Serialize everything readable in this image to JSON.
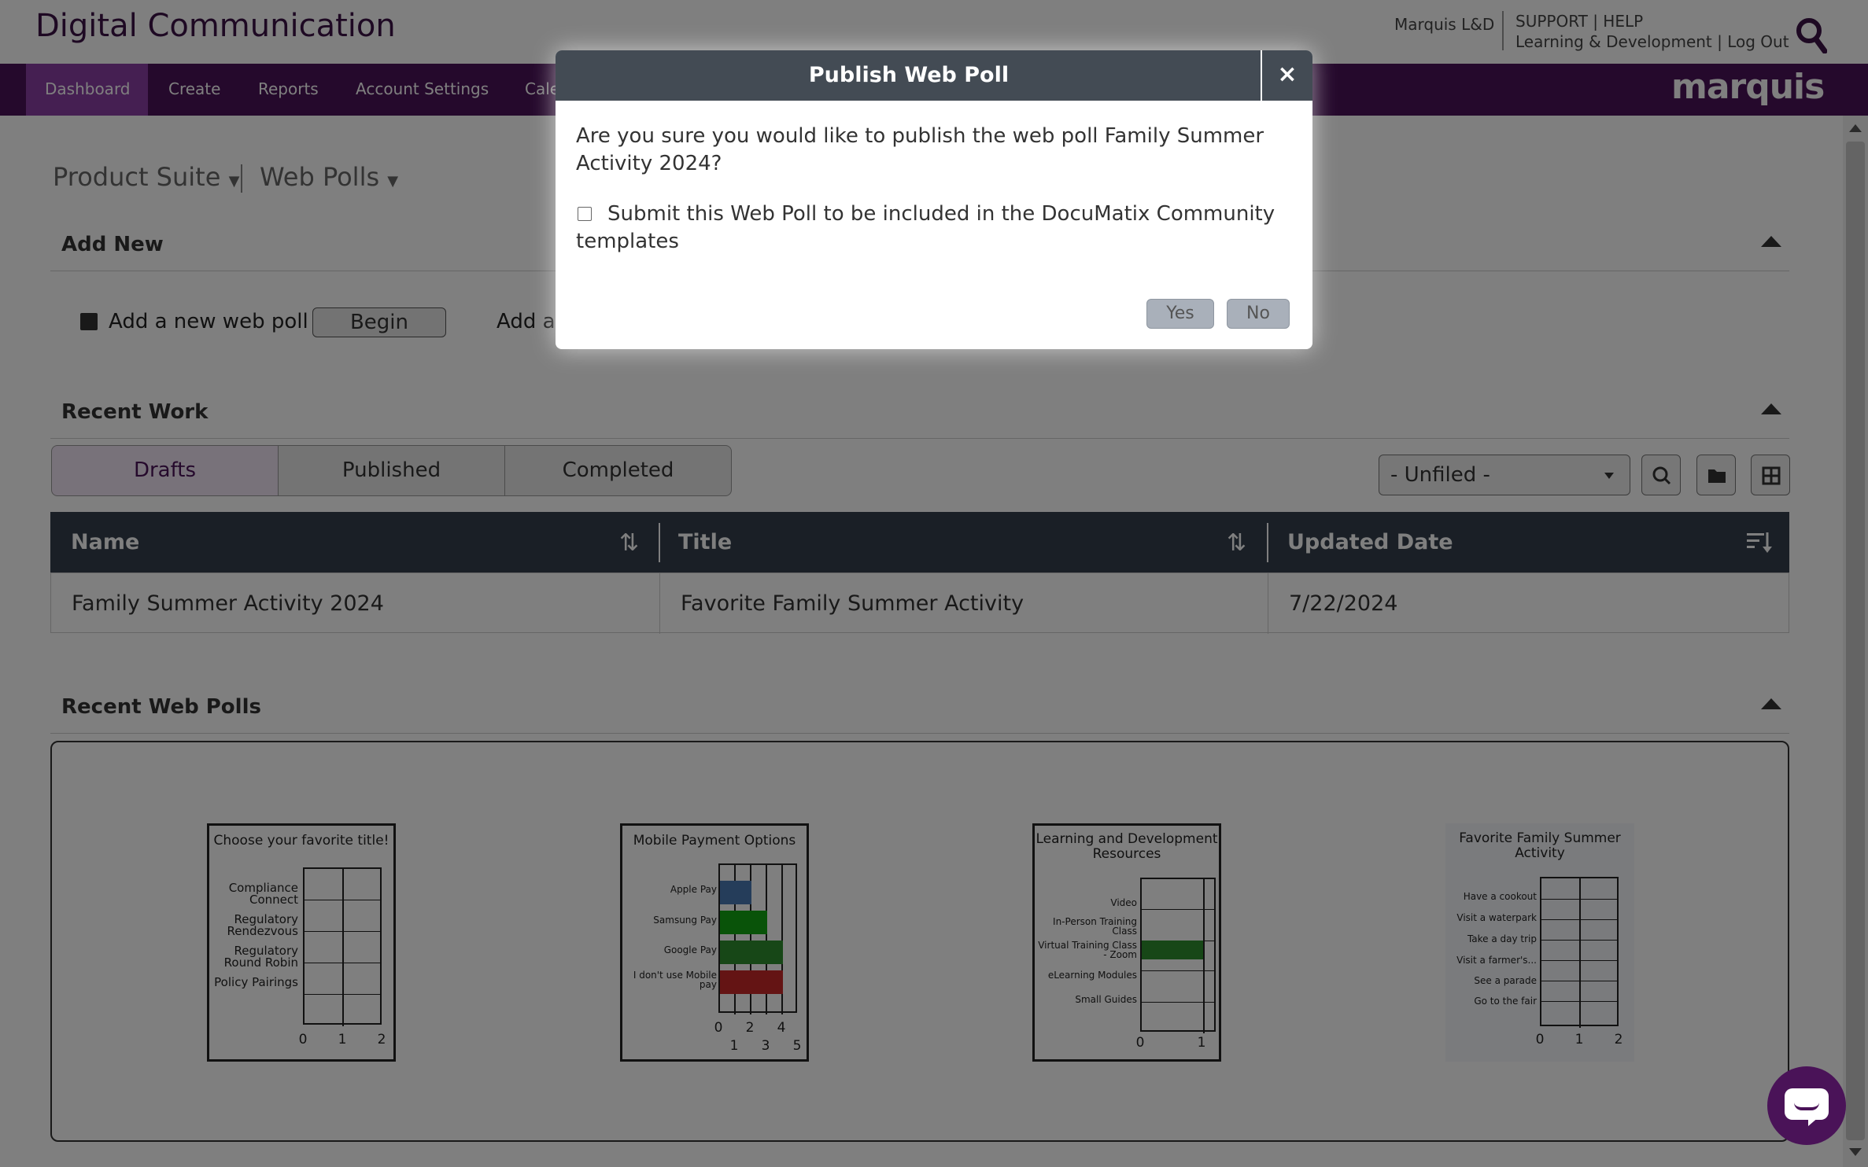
{
  "header": {
    "brand": "Digital Communication",
    "user": "Marquis L&D",
    "links_line1": "SUPPORT | HELP",
    "links_line2": "Learning & Development | Log Out",
    "logo": "marquis"
  },
  "nav": {
    "items": [
      {
        "label": "Dashboard",
        "active": true
      },
      {
        "label": "Create"
      },
      {
        "label": "Reports"
      },
      {
        "label": "Account Settings"
      },
      {
        "label": "Cale"
      }
    ]
  },
  "breadcrumb": {
    "suite": "Product Suite",
    "section": "Web Polls"
  },
  "add_new": {
    "title": "Add New",
    "new_poll_label": "Add a new web poll",
    "begin_label": "Begin",
    "second_label": "Add a"
  },
  "recent_work": {
    "title": "Recent Work",
    "tabs": [
      "Drafts",
      "Published",
      "Completed"
    ],
    "folder_select": "- Unfiled -",
    "columns": [
      "Name",
      "Title",
      "Updated Date"
    ],
    "rows": [
      {
        "name": "Family Summer Activity 2024",
        "title": "Favorite Family Summer Activity",
        "updated": "7/22/2024"
      }
    ]
  },
  "recent_polls": {
    "title": "Recent Web Polls"
  },
  "chart_data": [
    {
      "type": "bar",
      "title": "Choose your favorite title!",
      "categories": [
        "Compliance Connect",
        "Regulatory Rendezvous",
        "Regulatory Round Robin",
        "Policy Pairings"
      ],
      "values": [
        0,
        0,
        0,
        0
      ],
      "xticks": [
        "0",
        "1",
        "2"
      ],
      "xlim": [
        0,
        2
      ]
    },
    {
      "type": "bar",
      "title": "Mobile Payment Options",
      "categories": [
        "Apple Pay",
        "Samsung Pay",
        "Google Pay",
        "I don't use Mobile pay"
      ],
      "values": [
        2,
        3,
        4,
        4
      ],
      "colors": [
        "#4a7ab5",
        "#12a612",
        "#2f8f2f",
        "#c82828"
      ],
      "xticks_top": [
        "0",
        "2",
        "4"
      ],
      "xticks_bottom": [
        "1",
        "3",
        "5"
      ],
      "xlim": [
        0,
        5
      ]
    },
    {
      "type": "bar",
      "title": "Learning and Development Resources",
      "categories": [
        "Video",
        "In-Person Training Class",
        "Virtual Training Class - Zoom",
        "eLearning Modules",
        "Small Guides"
      ],
      "values": [
        0,
        0,
        1,
        0,
        0
      ],
      "colors": [
        "#2f8f2f"
      ],
      "xticks": [
        "0",
        "1"
      ],
      "xlim": [
        0,
        1
      ]
    },
    {
      "type": "bar",
      "title": "Favorite Family Summer Activity",
      "categories": [
        "Have a cookout",
        "Visit a waterpark",
        "Take a day trip",
        "Visit a farmer's...",
        "See a parade",
        "Go to the fair"
      ],
      "values": [
        0,
        0,
        0,
        0,
        0,
        0
      ],
      "xticks": [
        "0",
        "1",
        "2"
      ],
      "xlim": [
        0,
        2
      ]
    }
  ],
  "modal": {
    "title": "Publish Web Poll",
    "close": "×",
    "question": "Are you sure you would like to publish the web poll Family Summer Activity 2024?",
    "checkbox_label": "Submit this Web Poll to be included in the DocuMatix Community templates",
    "yes": "Yes",
    "no": "No"
  },
  "colors": {
    "brand_purple": "#4a1358",
    "nav_active": "#8b3ea5",
    "table_header": "#343f4c",
    "modal_header": "#434b54"
  }
}
